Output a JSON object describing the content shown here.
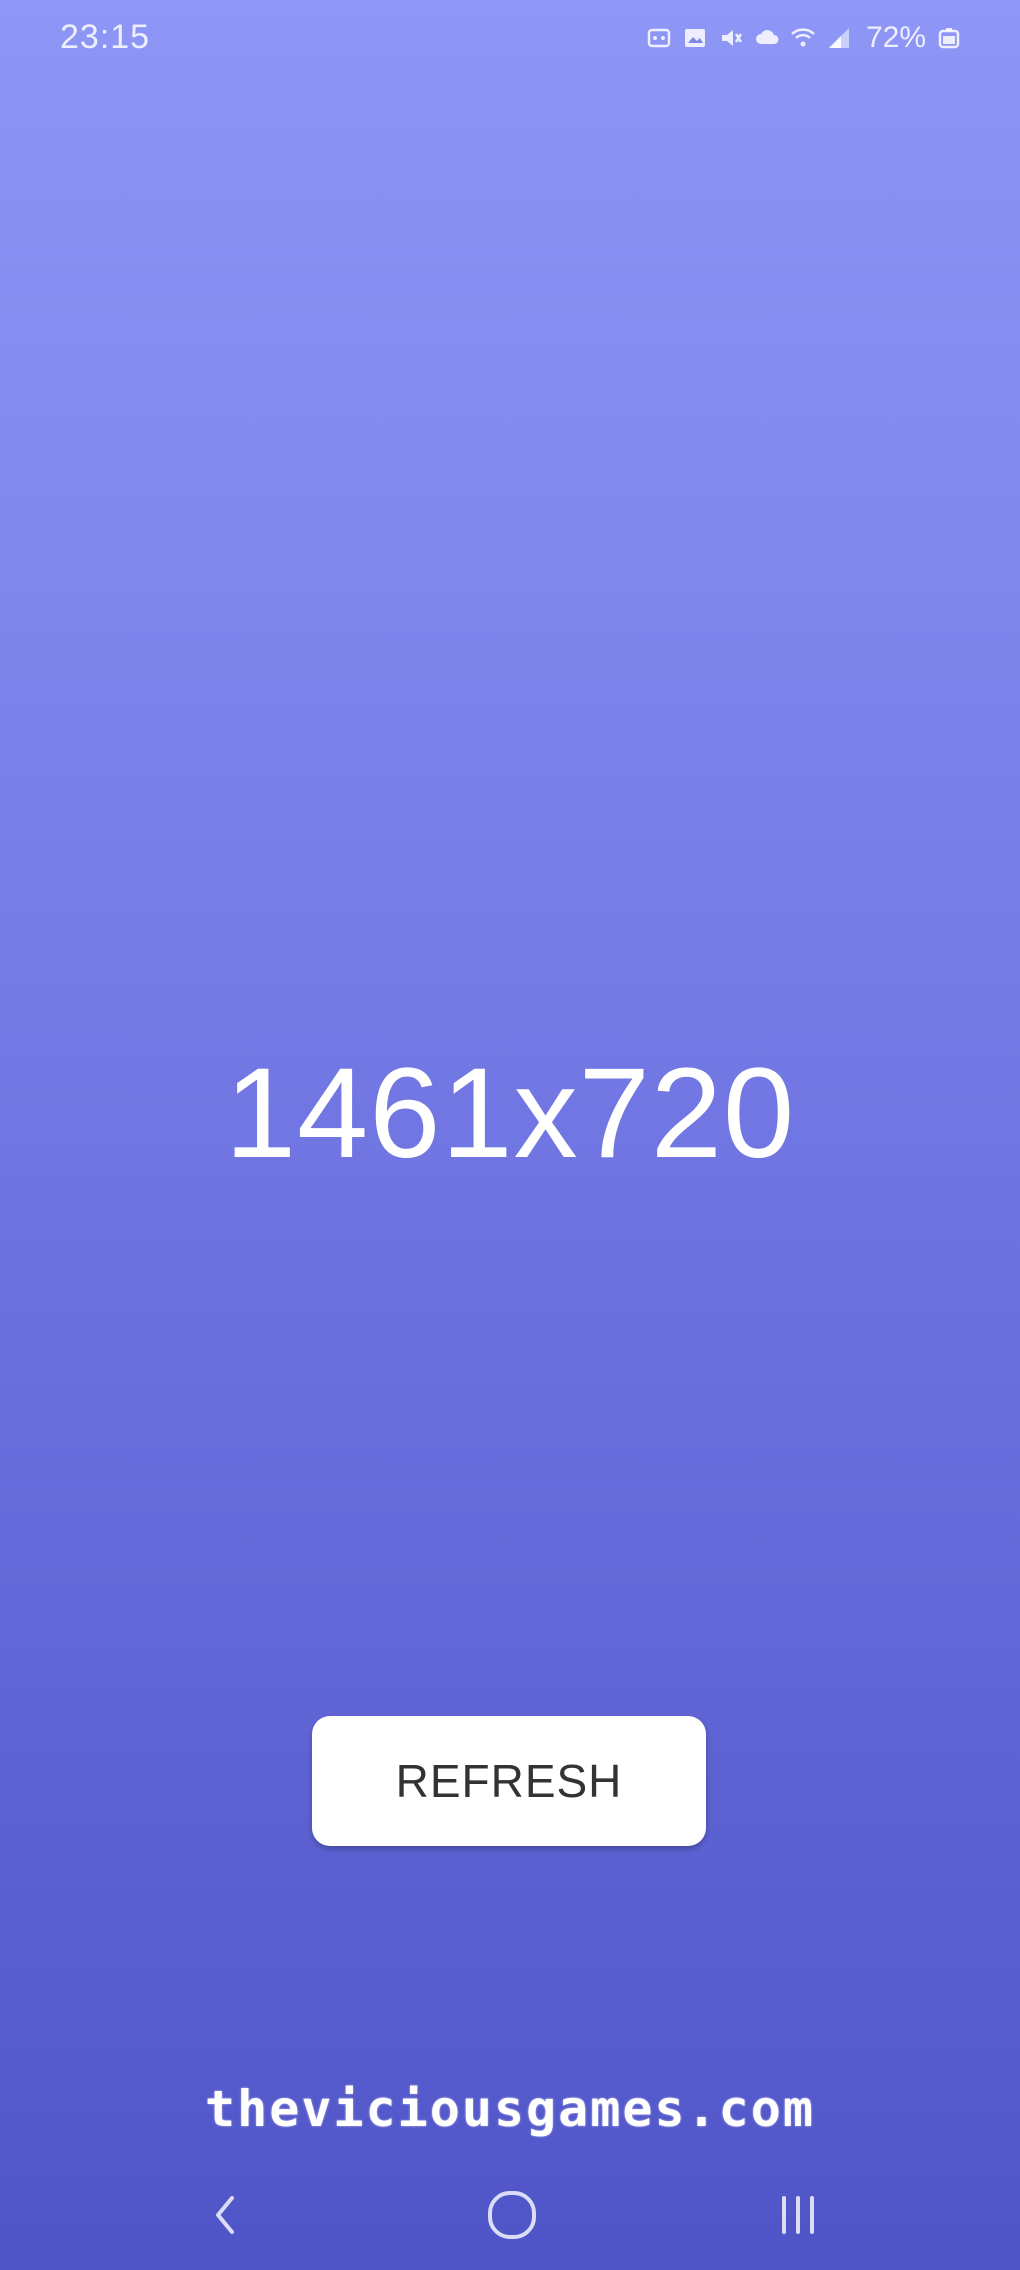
{
  "status_bar": {
    "time": "23:15",
    "battery_text": "72%",
    "icons": [
      "notification-icon",
      "gallery-icon",
      "mute-icon",
      "cloud-icon",
      "wifi-icon",
      "signal-icon",
      "battery-icon"
    ]
  },
  "main": {
    "resolution": "1461x720",
    "refresh_label": "REFRESH",
    "site_text": "theviciousgames.com"
  },
  "nav_bar": {
    "items": [
      "back-icon",
      "home-icon",
      "recents-icon"
    ]
  },
  "colors": {
    "gradient_top": "#8e96f6",
    "gradient_bottom": "#4f54c7",
    "button_bg": "#ffffff",
    "button_text": "#333333"
  }
}
